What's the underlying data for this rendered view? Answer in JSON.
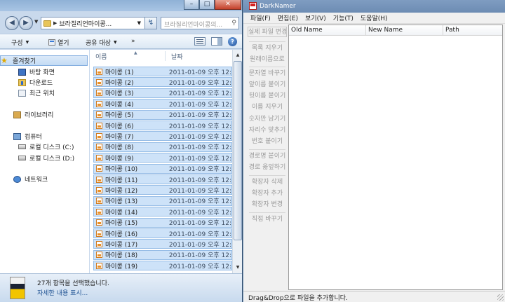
{
  "explorer": {
    "window_buttons": {
      "minimize": "–",
      "maximize": "□",
      "close": "✕"
    },
    "nav": {
      "back": "◀",
      "forward": "▶",
      "recent": "▼"
    },
    "address": {
      "separator": "▶",
      "path": "브라질리언마이콩...",
      "dropdown": "▼"
    },
    "refresh": "↯",
    "search_placeholder": "브라질리언마이콩의...",
    "toolbar": {
      "organize": "구성",
      "open": "열기",
      "share": "공유 대상",
      "more": "»"
    },
    "nav_pane": {
      "favorites": "즐겨찾기",
      "desktop": "바탕 화면",
      "downloads": "다운로드",
      "recent": "최근 위치",
      "libraries": "라이브러리",
      "computer": "컴퓨터",
      "disk_c": "로컬 디스크 (C:)",
      "disk_d": "로컬 디스크 (D:)",
      "network": "네트워크"
    },
    "columns": {
      "name": "이름",
      "date": "날짜"
    },
    "files": [
      {
        "name": "마이콩 (1)",
        "date": "2011-01-09 오후 12:"
      },
      {
        "name": "마이콩 (2)",
        "date": "2011-01-09 오후 12:"
      },
      {
        "name": "마이콩 (3)",
        "date": "2011-01-09 오후 12:"
      },
      {
        "name": "마이콩 (4)",
        "date": "2011-01-09 오후 12:"
      },
      {
        "name": "마이콩 (5)",
        "date": "2011-01-09 오후 12:"
      },
      {
        "name": "마이콩 (6)",
        "date": "2011-01-09 오후 12:"
      },
      {
        "name": "마이콩 (7)",
        "date": "2011-01-09 오후 12:"
      },
      {
        "name": "마이콩 (8)",
        "date": "2011-01-09 오후 12:"
      },
      {
        "name": "마이콩 (9)",
        "date": "2011-01-09 오후 12:"
      },
      {
        "name": "마이콩 (10)",
        "date": "2011-01-09 오후 12:"
      },
      {
        "name": "마이콩 (11)",
        "date": "2011-01-09 오후 12:"
      },
      {
        "name": "마이콩 (12)",
        "date": "2011-01-09 오후 12:"
      },
      {
        "name": "마이콩 (13)",
        "date": "2011-01-09 오후 12:"
      },
      {
        "name": "마이콩 (14)",
        "date": "2011-01-09 오후 12:"
      },
      {
        "name": "마이콩 (15)",
        "date": "2011-01-09 오후 12:"
      },
      {
        "name": "마이콩 (16)",
        "date": "2011-01-09 오후 12:"
      },
      {
        "name": "마이콩 (17)",
        "date": "2011-01-09 오후 12:"
      },
      {
        "name": "마이콩 (18)",
        "date": "2011-01-09 오후 12:"
      },
      {
        "name": "마이콩 (19)",
        "date": "2011-01-09 오후 12:"
      }
    ],
    "details": {
      "summary": "27개 항목을 선택했습니다.",
      "show_more": "자세한 내용 표시..."
    }
  },
  "darknamer": {
    "title": "DarkNamer",
    "menu": [
      "파일(F)",
      "편집(E)",
      "보기(V)",
      "기능(T)",
      "도움말(H)"
    ],
    "side_buttons": [
      "실제 파일 변경",
      "목록 지우기",
      "원래이름으로",
      "문자열 바꾸기",
      "앞이름 붙이기",
      "뒷이름 붙이기",
      "이름 지우기",
      "숫자만 남기기",
      "자리수 맞추기",
      "번호 붙이기",
      "경로명 붙이기",
      "경로 옮엎하기",
      "확장자 삭제",
      "확장자 추가",
      "확장자 변경",
      "직접 바꾸기"
    ],
    "columns": {
      "old": "Old Name",
      "new": "New Name",
      "path": "Path"
    },
    "status": "Drag&Drop으로 파일을 추가합니다."
  }
}
